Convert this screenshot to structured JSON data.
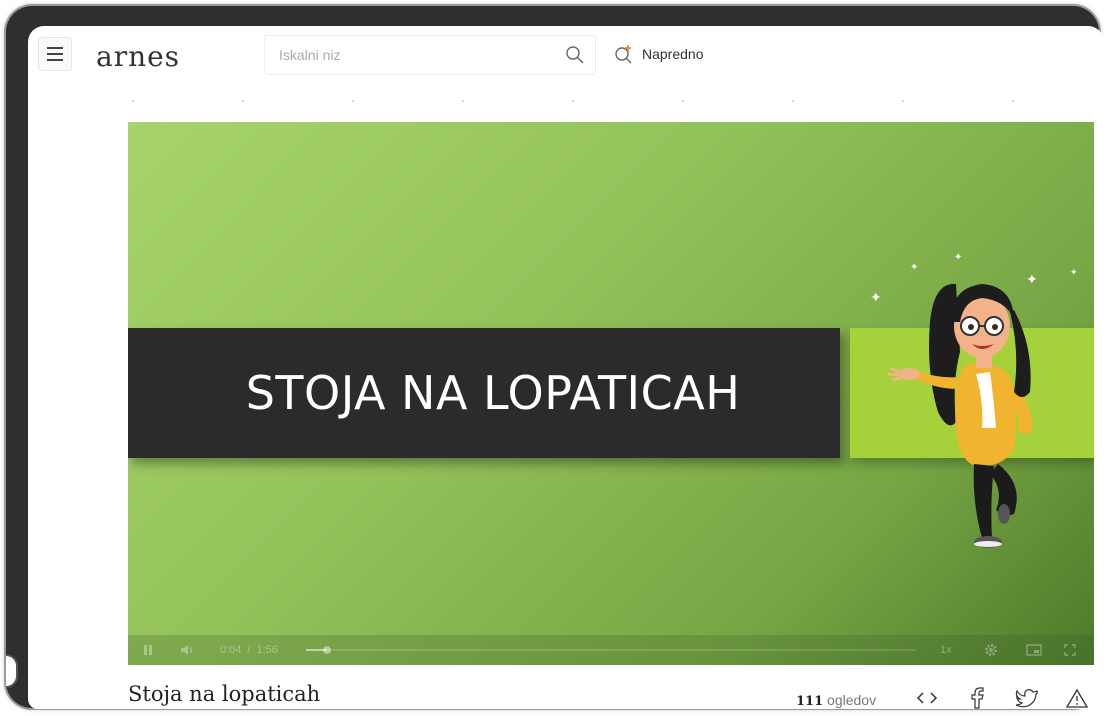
{
  "header": {
    "logo_text": "arnes",
    "search": {
      "placeholder": "Iskalni niz",
      "value": ""
    },
    "advanced_label": "Napredno"
  },
  "video": {
    "slide_title": "STOJA NA LOPATICAH",
    "player": {
      "current_time": "0:04",
      "separator": "/",
      "duration": "1:56",
      "progress": 0.034,
      "speed": "1x"
    }
  },
  "details": {
    "title": "Stoja na lopaticah",
    "views_count": "111",
    "views_label": "ogledov"
  },
  "colors": {
    "brand_accent": "#e8742f",
    "video_bg_light": "#a7d46c",
    "video_bg_dark": "#4c7a2a",
    "title_band": "#2b2b2b",
    "green_band": "#a5d13b"
  },
  "icons": [
    "menu-icon",
    "logo-mark-icon",
    "search-icon",
    "advanced-search-icon",
    "pause-icon",
    "volume-icon",
    "settings-icon",
    "pip-icon",
    "fullscreen-icon",
    "embed-icon",
    "facebook-icon",
    "twitter-icon",
    "report-icon"
  ]
}
